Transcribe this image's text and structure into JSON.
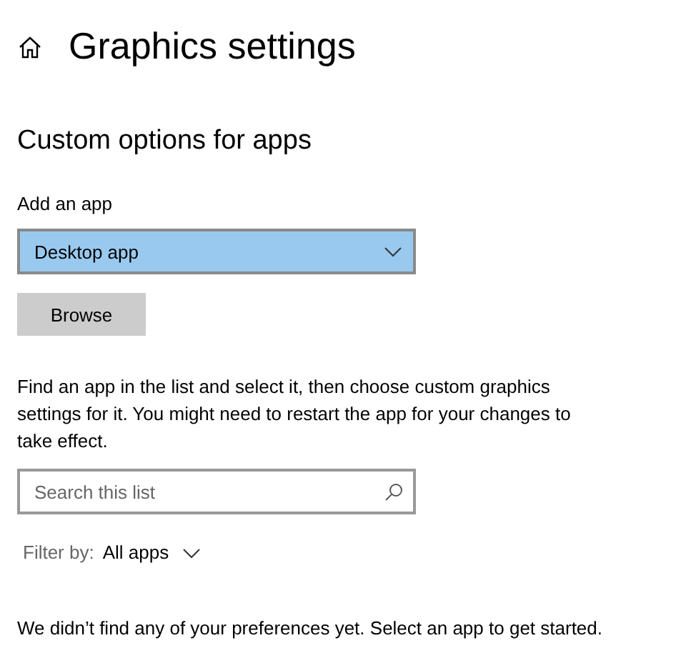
{
  "header": {
    "title": "Graphics settings"
  },
  "section": {
    "title": "Custom options for apps"
  },
  "add_app": {
    "label": "Add an app",
    "dropdown_value": "Desktop app",
    "browse_button": "Browse"
  },
  "description": "Find an app in the list and select it, then choose custom graphics settings for it. You might need to restart the app for your changes to take effect.",
  "search": {
    "placeholder": "Search this list"
  },
  "filter": {
    "label": "Filter by:",
    "value": "All apps"
  },
  "empty_message": "We didn’t find any of your preferences yet. Select an app to get started."
}
